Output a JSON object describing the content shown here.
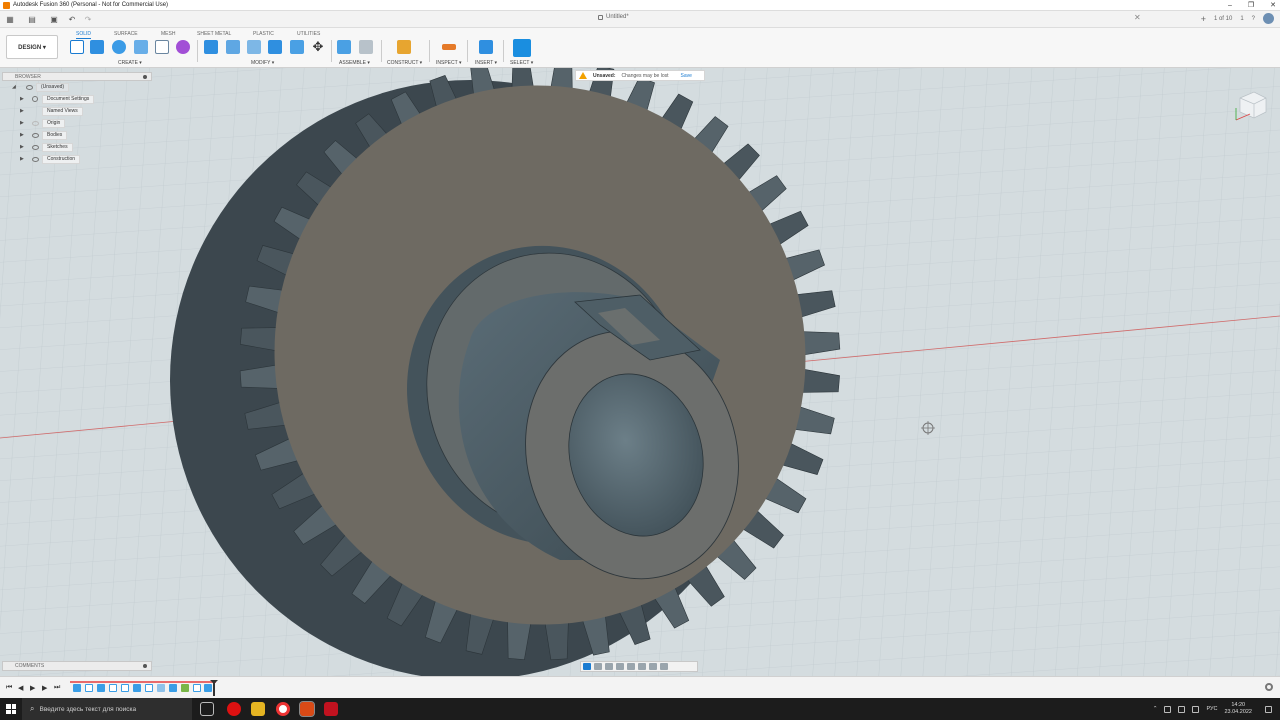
{
  "window": {
    "title": "Autodesk Fusion 360 (Personal - Not for Commercial Use)",
    "controls": [
      "–",
      "❐",
      "✕"
    ]
  },
  "quick_access": {
    "document_tab": "Untitled*",
    "tab_close": "✕",
    "right_tools": {
      "plus": "+",
      "counter": "1 of 10",
      "notifications": "1",
      "help": "?"
    }
  },
  "toolbar": {
    "workspace": "DESIGN ▾",
    "tabs": [
      "SOLID",
      "SURFACE",
      "MESH",
      "SHEET METAL",
      "PLASTIC",
      "UTILITIES"
    ],
    "active_tab": "SOLID",
    "groups": {
      "create": "CREATE ▾",
      "modify": "MODIFY ▾",
      "assemble": "ASSEMBLE ▾",
      "construct": "CONSTRUCT ▾",
      "inspect": "INSPECT ▾",
      "insert": "INSERT ▾",
      "select": "SELECT ▾"
    }
  },
  "browser": {
    "header": "BROWSER",
    "items": [
      {
        "label": "(Unsaved)",
        "root": true
      },
      {
        "label": "Document Settings"
      },
      {
        "label": "Named Views"
      },
      {
        "label": "Origin"
      },
      {
        "label": "Bodies"
      },
      {
        "label": "Sketches"
      },
      {
        "label": "Construction"
      }
    ]
  },
  "notice": {
    "title": "Unsaved:",
    "message": "Changes may be lost",
    "action": "Save"
  },
  "comments": {
    "header": "COMMENTS"
  },
  "timeline": {
    "controls": [
      "⏮",
      "◀",
      "▶",
      "▶",
      "⏭"
    ]
  },
  "taskbar": {
    "search_placeholder": "Введите здесь текст для поиска",
    "language": "РУС",
    "time": "14:20",
    "date": "23.04.2022"
  },
  "colors": {
    "accent": "#1a7bd1",
    "gear_face": "#6e6a62",
    "gear_teeth": "#46525a",
    "hub": "#4f5f68",
    "viewport_bg": "#d4dcdf"
  }
}
